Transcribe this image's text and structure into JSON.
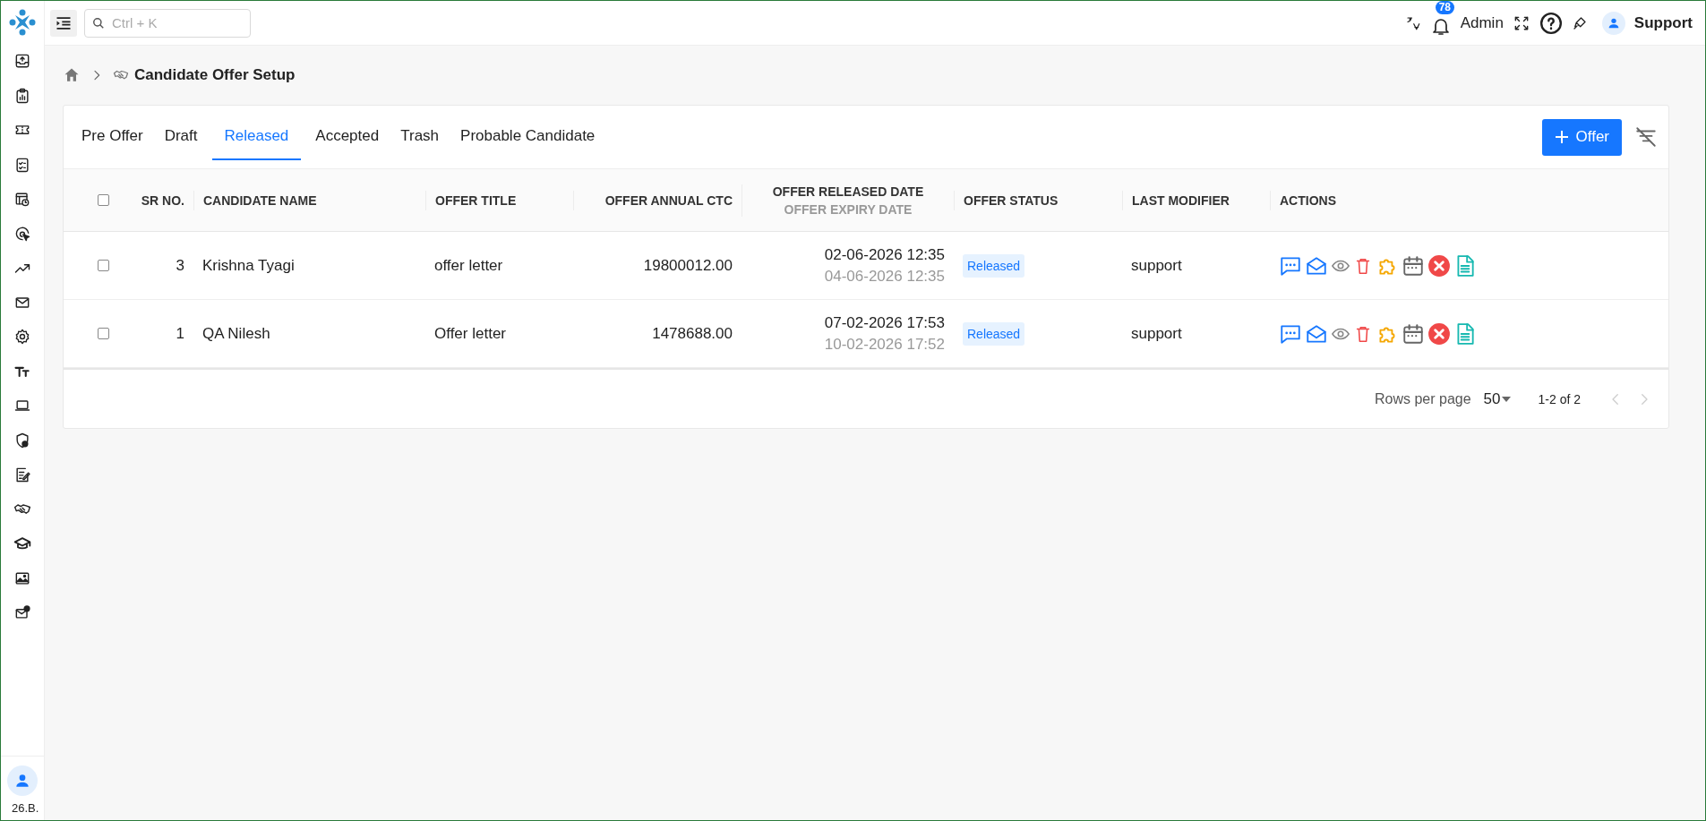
{
  "topbar": {
    "search": {
      "placeholder": "Ctrl + K"
    },
    "notification_count": "78",
    "role": "Admin",
    "user": "Support"
  },
  "sidebar": {
    "version": "26.B."
  },
  "breadcrumb": {
    "title": "Candidate Offer Setup"
  },
  "tabs": [
    {
      "label": "Pre Offer",
      "selected": false
    },
    {
      "label": "Draft",
      "selected": false
    },
    {
      "label": "Released",
      "selected": true
    },
    {
      "label": "Accepted",
      "selected": false
    },
    {
      "label": "Trash",
      "selected": false
    },
    {
      "label": "Probable Candidate",
      "selected": false
    }
  ],
  "add_button": {
    "label": "Offer"
  },
  "table": {
    "select_all": {
      "checked": false
    },
    "columns": [
      {
        "label": "SR NO."
      },
      {
        "label": "CANDIDATE NAME"
      },
      {
        "label": "OFFER TITLE"
      },
      {
        "label": "OFFER ANNUAL CTC"
      },
      {
        "label": "OFFER RELEASED DATE",
        "sublabel": "OFFER EXPIRY DATE"
      },
      {
        "label": "OFFER STATUS"
      },
      {
        "label": "LAST MODIFIER"
      },
      {
        "label": "ACTIONS"
      }
    ],
    "rows": [
      {
        "checked": false,
        "sr_no": "3",
        "candidate_name": "Krishna Tyagi",
        "offer_title": "offer letter",
        "annual_ctc": "19800012.00",
        "released_date": "02-06-2026 12:35",
        "expiry_date": "04-06-2026 12:35",
        "status": "Released",
        "last_modifier": "support"
      },
      {
        "checked": false,
        "sr_no": "1",
        "candidate_name": "QA Nilesh",
        "offer_title": "Offer letter",
        "annual_ctc": "1478688.00",
        "released_date": "07-02-2026 17:53",
        "expiry_date": "10-02-2026 17:52",
        "status": "Released",
        "last_modifier": "support"
      }
    ]
  },
  "pagination": {
    "rows_per_page_label": "Rows per page",
    "rows_per_page": "50",
    "range": "1-2 of 2"
  }
}
